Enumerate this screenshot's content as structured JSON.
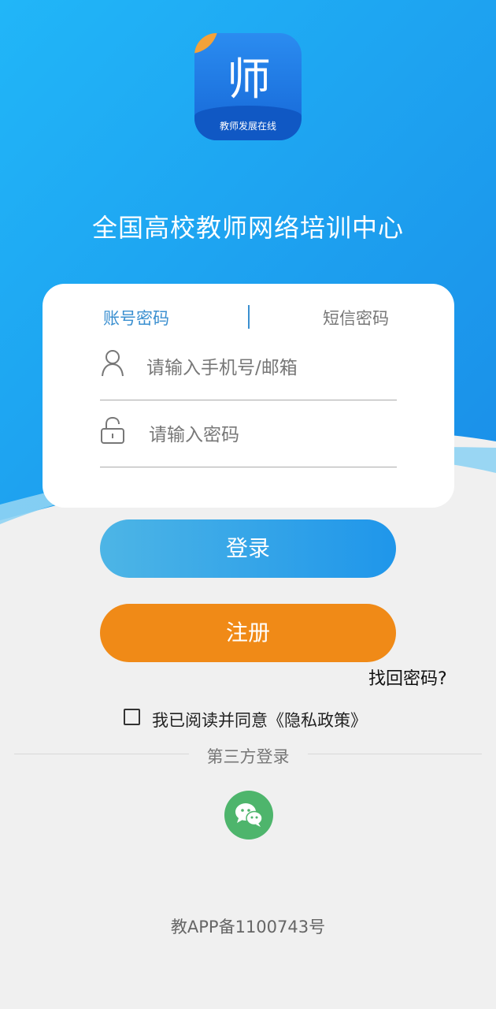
{
  "app": {
    "logo_glyph": "师",
    "logo_text": "教师发展在线",
    "title": "全国高校教师网络培训中心"
  },
  "login_card": {
    "tabs": [
      {
        "label": "账号密码",
        "active": true
      },
      {
        "label": "短信密码",
        "active": false
      }
    ],
    "account_field": {
      "placeholder": "请输入手机号/邮箱",
      "icon": "user-icon"
    },
    "password_field": {
      "placeholder": "请输入密码",
      "icon": "lock-icon"
    }
  },
  "actions": {
    "login_label": "登录",
    "register_label": "注册",
    "forgot_label": "找回密码?"
  },
  "agreement": {
    "checked": false,
    "text": "我已阅读并同意《隐私政策》"
  },
  "third_party": {
    "label": "第三方登录",
    "providers": [
      {
        "name": "wechat",
        "icon": "wechat-icon",
        "color": "#4eb56c"
      }
    ]
  },
  "footer": {
    "icp": "教APP备1100743号"
  },
  "colors": {
    "accent": "#1f96ea",
    "register": "#f08a17",
    "tab_active": "#3a8fd0"
  }
}
